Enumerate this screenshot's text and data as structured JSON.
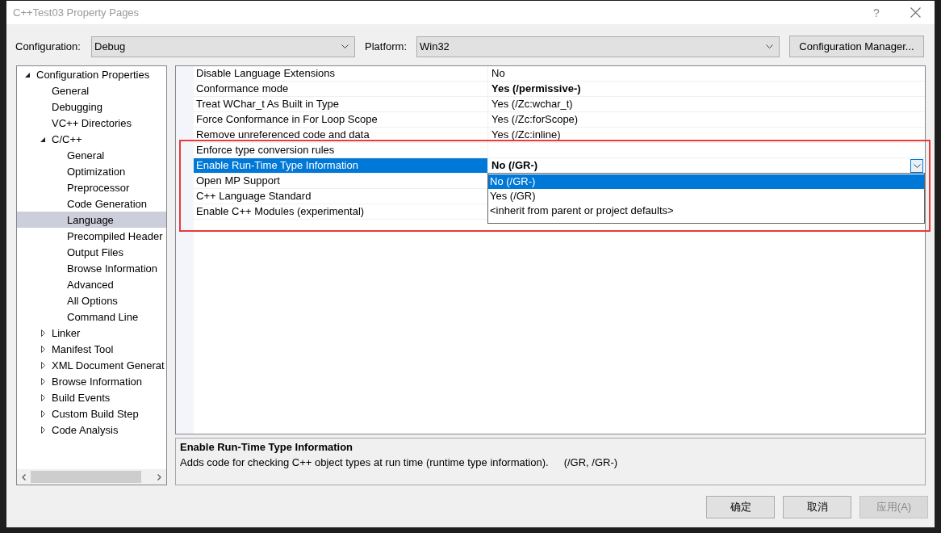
{
  "window": {
    "title": "C++Test03 Property Pages",
    "help": "?"
  },
  "configuration": {
    "label": "Configuration:",
    "value": "Debug"
  },
  "platform": {
    "label": "Platform:",
    "value": "Win32"
  },
  "configuration_manager": "Configuration Manager...",
  "tree": {
    "items": [
      {
        "label": "Configuration Properties",
        "kind": "group",
        "expanded": true,
        "selected": false,
        "children": [
          {
            "label": "General",
            "kind": "page",
            "selected": false
          },
          {
            "label": "Debugging",
            "kind": "page",
            "selected": false
          },
          {
            "label": "VC++ Directories",
            "kind": "page",
            "selected": false
          },
          {
            "label": "C/C++",
            "kind": "group",
            "expanded": true,
            "selected": false,
            "children": [
              {
                "label": "General",
                "kind": "page",
                "selected": false
              },
              {
                "label": "Optimization",
                "kind": "page",
                "selected": false
              },
              {
                "label": "Preprocessor",
                "kind": "page",
                "selected": false
              },
              {
                "label": "Code Generation",
                "kind": "page",
                "selected": false
              },
              {
                "label": "Language",
                "kind": "page",
                "selected": true
              },
              {
                "label": "Precompiled Header",
                "kind": "page",
                "selected": false
              },
              {
                "label": "Output Files",
                "kind": "page",
                "selected": false
              },
              {
                "label": "Browse Information",
                "kind": "page",
                "selected": false
              },
              {
                "label": "Advanced",
                "kind": "page",
                "selected": false
              },
              {
                "label": "All Options",
                "kind": "page",
                "selected": false
              },
              {
                "label": "Command Line",
                "kind": "page",
                "selected": false
              }
            ]
          },
          {
            "label": "Linker",
            "kind": "group",
            "expanded": false,
            "selected": false
          },
          {
            "label": "Manifest Tool",
            "kind": "group",
            "expanded": false,
            "selected": false
          },
          {
            "label": "XML Document Generat",
            "kind": "group",
            "expanded": false,
            "selected": false
          },
          {
            "label": "Browse Information",
            "kind": "group",
            "expanded": false,
            "selected": false
          },
          {
            "label": "Build Events",
            "kind": "group",
            "expanded": false,
            "selected": false
          },
          {
            "label": "Custom Build Step",
            "kind": "group",
            "expanded": false,
            "selected": false
          },
          {
            "label": "Code Analysis",
            "kind": "group",
            "expanded": false,
            "selected": false
          }
        ]
      }
    ]
  },
  "grid": {
    "rows": [
      {
        "name": "Disable Language Extensions",
        "value": "No",
        "modified": false,
        "selected": false
      },
      {
        "name": "Conformance mode",
        "value": "Yes (/permissive-)",
        "modified": true,
        "selected": false
      },
      {
        "name": "Treat WChar_t As Built in Type",
        "value": "Yes (/Zc:wchar_t)",
        "modified": false,
        "selected": false
      },
      {
        "name": "Force Conformance in For Loop Scope",
        "value": "Yes (/Zc:forScope)",
        "modified": false,
        "selected": false
      },
      {
        "name": "Remove unreferenced code and data",
        "value": "Yes (/Zc:inline)",
        "modified": false,
        "selected": false
      },
      {
        "name": "Enforce type conversion rules",
        "selected": false
      },
      {
        "name": "Enable Run-Time Type Information",
        "value": "No (/GR-)",
        "modified": true,
        "selected": true,
        "options": [
          {
            "label": "No (/GR-)",
            "selected": true
          },
          {
            "label": "Yes (/GR)",
            "selected": false
          },
          {
            "label": "<inherit from parent or project defaults>",
            "selected": false
          }
        ]
      },
      {
        "name": "Open MP Support",
        "selected": false
      },
      {
        "name": "C++ Language Standard",
        "selected": false
      },
      {
        "name": "Enable C++ Modules (experimental)",
        "selected": false
      }
    ]
  },
  "description": {
    "title": "Enable Run-Time Type Information",
    "text": "Adds code for checking C++ object types at run time (runtime type information).",
    "switches": "(/GR, /GR-)"
  },
  "buttons": [
    {
      "label": "确定",
      "disabled": false
    },
    {
      "label": "取消",
      "disabled": false
    },
    {
      "label": "应用(A)",
      "disabled": true
    }
  ]
}
